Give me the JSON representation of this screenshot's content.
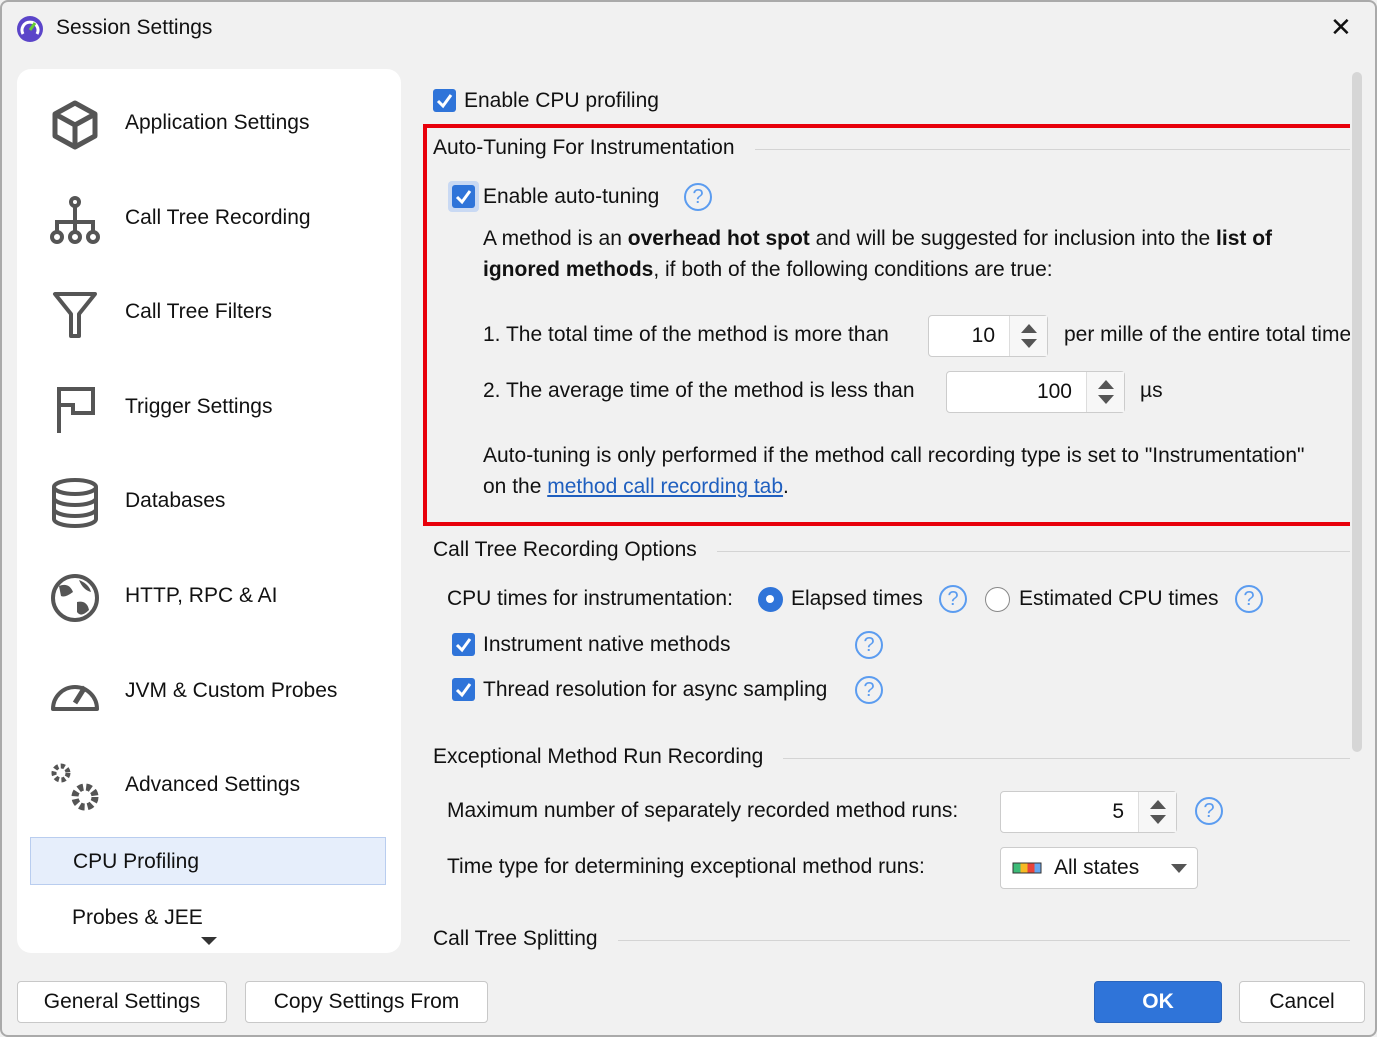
{
  "window": {
    "title": "Session Settings",
    "close": "✕"
  },
  "sidebar": {
    "items": [
      {
        "label": "Application Settings",
        "icon": "cube-icon"
      },
      {
        "label": "Call Tree Recording",
        "icon": "hierarchy-icon"
      },
      {
        "label": "Call Tree Filters",
        "icon": "filter-icon"
      },
      {
        "label": "Trigger Settings",
        "icon": "flag-icon"
      },
      {
        "label": "Databases",
        "icon": "database-icon"
      },
      {
        "label": "HTTP, RPC & AI",
        "icon": "globe-icon"
      },
      {
        "label": "JVM & Custom Probes",
        "icon": "gauge-icon"
      },
      {
        "label": "Advanced Settings",
        "icon": "gears-icon"
      }
    ],
    "subitems": [
      {
        "label": "CPU Profiling",
        "selected": true
      },
      {
        "label": "Probes & JEE",
        "selected": false
      }
    ]
  },
  "content": {
    "enable_cpu": {
      "label": "Enable CPU profiling",
      "checked": true
    },
    "autotune": {
      "title": "Auto-Tuning For Instrumentation",
      "enable_label": "Enable auto-tuning",
      "checked": true,
      "desc1a": "A method is an ",
      "desc1b": "overhead hot spot",
      "desc1c": " and will be suggested for inclusion into the ",
      "desc1d": "list of",
      "desc2a": "ignored methods",
      "desc2b": ", if both of the following conditions are true:",
      "cond1": "1. The total time of the method is more than",
      "cond1_value": "10",
      "cond1_unit": "per mille of the entire total time",
      "cond2": "2. The average time of the method is less than",
      "cond2_value": "100",
      "cond2_unit": "µs",
      "note1": "Auto-tuning is only performed if the method call recording type is set to \"Instrumentation\"",
      "note2a": "on the ",
      "note2_link": "method call recording tab",
      "note2b": "."
    },
    "ctro": {
      "title": "Call Tree Recording Options",
      "cpu_times_label": "CPU times for instrumentation:",
      "elapsed": "Elapsed times",
      "estimated": "Estimated CPU times",
      "selected": "Elapsed times",
      "native": {
        "label": "Instrument native methods",
        "checked": true
      },
      "thread": {
        "label": "Thread resolution for async sampling",
        "checked": true
      }
    },
    "exc": {
      "title": "Exceptional Method Run Recording",
      "max_label": "Maximum number of separately recorded method runs:",
      "max_value": "5",
      "time_label": "Time type for determining exceptional method runs:",
      "time_value": "All states"
    },
    "split": {
      "title": "Call Tree Splitting"
    }
  },
  "footer": {
    "general": "General Settings",
    "copy": "Copy Settings From",
    "ok": "OK",
    "cancel": "Cancel"
  },
  "colors": {
    "accent": "#2f74d9",
    "highlight": "#e8000b"
  }
}
